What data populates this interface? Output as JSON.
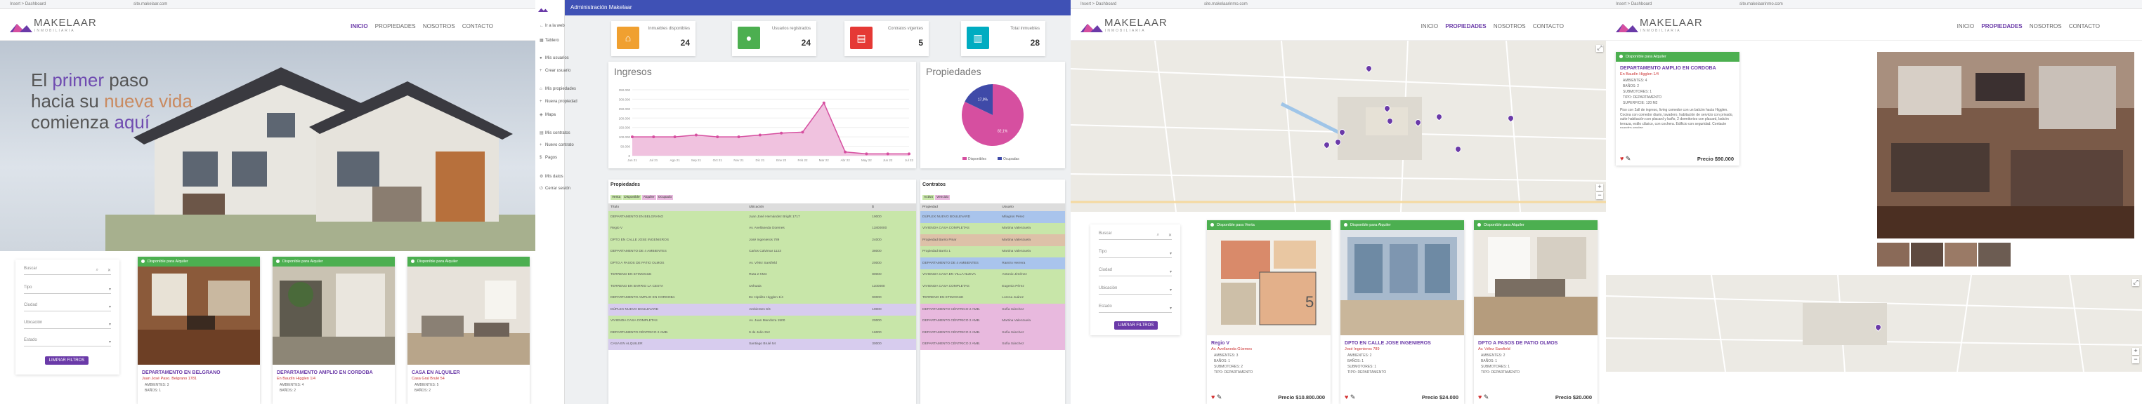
{
  "browser": {
    "left": "Insert > Dashboard",
    "url": "site.makelaar.com",
    "url2": "site.makelaarinmo.com"
  },
  "brand": {
    "name": "MAKELAAR",
    "tagline": "INMOBILIARIA",
    "accent": "#6a3aa8",
    "green": "#4caf50"
  },
  "nav": {
    "items": [
      "INICIO",
      "PROPIEDADES",
      "NOSOTROS",
      "CONTACTO"
    ]
  },
  "hero": {
    "line1a": "El ",
    "line1b": "primer",
    "line1c": " paso",
    "line2a": "hacia su ",
    "line2b": "nueva vida",
    "line3a": "comienza ",
    "line3b": "aquí"
  },
  "filters": {
    "search_placeholder": "Buscar",
    "fields": [
      "Tipo",
      "Ciudad",
      "Ubicación",
      "Estado"
    ],
    "clear_button": "LIMPIAR FILTROS"
  },
  "home_cards": [
    {
      "badge": "Disponible para Alquiler",
      "title": "DEPARTAMENTO EN BELGRANO",
      "address": "Juan José Paso. Belgrano 1781",
      "features": [
        "AMBIENTES: 3",
        "BAÑOS: 1"
      ]
    },
    {
      "badge": "Disponible para Alquiler",
      "title": "DEPARTAMENTO AMPLIO EN CORDOBA",
      "address": "En Baudín Higglen 1/4",
      "features": [
        "AMBIENTES: 4",
        "BAÑOS: 2"
      ]
    },
    {
      "badge": "Disponible para Alquiler",
      "title": "CASA EN ALQUILER",
      "address": "Casa Gral Brulé 54",
      "features": [
        "AMBIENTES: 5",
        "BAÑOS: 2"
      ]
    }
  ],
  "admin": {
    "header": "Administración Makelaar",
    "sidebar": [
      "Ir a la web",
      "Tablero",
      "Mis usuarios",
      "Crear usuario",
      "Mis propiedades",
      "Nueva propiedad",
      "Mapa",
      "Mis contratos",
      "Nuevo contrato",
      "Pagos",
      "Mis datos",
      "Cerrar sesión"
    ],
    "stats": [
      {
        "label": "Inmuebles disponibles",
        "value": "24",
        "color": "#f0a030",
        "icon": "home-icon",
        "glyph": "⌂"
      },
      {
        "label": "Usuarios registrados",
        "value": "24",
        "color": "#4caf50",
        "icon": "user-icon",
        "glyph": "●"
      },
      {
        "label": "Contratos vigentes",
        "value": "5",
        "color": "#e53935",
        "icon": "document-icon",
        "glyph": "▤"
      },
      {
        "label": "Total inmuebles",
        "value": "28",
        "color": "#00acc1",
        "icon": "building-icon",
        "glyph": "▥"
      }
    ],
    "income_title": "Ingresos",
    "props_title": "Propiedades",
    "contracts_title": "Contratos",
    "pie_legend": [
      "Disponibles",
      "Ocupadas"
    ],
    "prop_tags": [
      "Venta",
      "Disponible",
      "Alquiler",
      "Ocupado"
    ],
    "contract_tags": [
      "Activo",
      "Vencido"
    ],
    "prop_headers": [
      "Título",
      "Ubicación",
      "$"
    ],
    "prop_rows": [
      {
        "c": "rg",
        "t": "DEPARTAMENTO EN BELGRANO",
        "u": "Juan José Hernández Bright 1717",
        "p": "19000"
      },
      {
        "c": "rg",
        "t": "Regio V",
        "u": "Av. Avellaneda Güemes",
        "p": "11800000"
      },
      {
        "c": "rg",
        "t": "DPTO EN CALLE JOSE INGENIEROS",
        "u": "José Ingenieros 789",
        "p": "24000"
      },
      {
        "c": "rg",
        "t": "DEPARTAMENTO DE 4 AMBIENTES",
        "u": "Carlos Calvimar 1123",
        "p": "38000"
      },
      {
        "c": "rg",
        "t": "DPTO A PASOS DE PATIO OLMOS",
        "u": "Av. Vélez Sarsfield",
        "p": "20000"
      },
      {
        "c": "rg",
        "t": "TERRENO EN ETIMOGUE",
        "u": "Ruta 2 KM4",
        "p": "80000"
      },
      {
        "c": "rg",
        "t": "TERRENO EN BARRIO LA CESTA",
        "u": "Ushuaia",
        "p": "1100000"
      },
      {
        "c": "rg",
        "t": "DEPARTAMENTO AMPLIO EN CORDOBA",
        "u": "En Hipólito Higglen 1/4",
        "p": "90000"
      },
      {
        "c": "rl",
        "t": "DÚPLEX NUEVO BOULEVARD",
        "u": "Ambientes 8/4",
        "p": "19000"
      },
      {
        "c": "rg",
        "t": "VIVIENDA CASA COMPLETAS",
        "u": "Av. Juan Mendoza 1500",
        "p": "20000"
      },
      {
        "c": "rg",
        "t": "DEPARTAMENTO CÉNTRICO 2 AMB.",
        "u": "9 de Julio 312",
        "p": "16000"
      },
      {
        "c": "rl",
        "t": "CASA EN ALQUILER",
        "u": "Santiago Brulé 54",
        "p": "30000"
      }
    ],
    "contract_headers": [
      "Propiedad",
      "Usuario"
    ],
    "contract_rows": [
      {
        "c": "rb",
        "t": "DÚPLEX NUEVO BOULEVARD",
        "u": "Milagros Pérez"
      },
      {
        "c": "rg",
        "t": "VIVIENDA CASA COMPLETAS",
        "u": "Martina Valenzuela"
      },
      {
        "c": "rw",
        "t": "Propiedad Barrio Pinar",
        "u": "Martina Valenzuela"
      },
      {
        "c": "rg",
        "t": "Propiedad Barrio 1",
        "u": "Martina Valenzuela"
      },
      {
        "c": "rb",
        "t": "DEPARTAMENTO DE 4 AMBIENTES",
        "u": "Ramiro Herrera"
      },
      {
        "c": "rg",
        "t": "VIVIENDA CASA EN VILLA NUEVA",
        "u": "Antonio Jiménez"
      },
      {
        "c": "rg",
        "t": "VIVIENDA CASA COMPLETAS",
        "u": "Eugenia Pérez"
      },
      {
        "c": "rg",
        "t": "TERRENO EN ETIMOGUE",
        "u": "Lorena Juárez"
      },
      {
        "c": "rp",
        "t": "DEPARTAMENTO CÉNTRICO 2 AMB.",
        "u": "Sofía Sánchez"
      },
      {
        "c": "rp",
        "t": "DEPARTAMENTO CÉNTRICO 2 AMB.",
        "u": "Martina Valenzuela"
      },
      {
        "c": "rp",
        "t": "DEPARTAMENTO CÉNTRICO 2 AMB.",
        "u": "Sofía Sánchez"
      },
      {
        "c": "rp",
        "t": "DEPARTAMENTO CÉNTRICO 2 AMB.",
        "u": "Sofía Sánchez"
      }
    ]
  },
  "chart_data": [
    {
      "type": "area",
      "title": "Ingresos",
      "x": [
        "Jun 21",
        "Jul 21",
        "Ago 21",
        "Sep 21",
        "Oct 21",
        "Nov 21",
        "Dic 21",
        "Ene 22",
        "Feb 22",
        "Mar 22",
        "Abr 22",
        "May 22",
        "Jun 22",
        "Jul 22"
      ],
      "values": [
        100000,
        100000,
        100000,
        110000,
        100000,
        100000,
        110000,
        120000,
        125000,
        280000,
        20000,
        10000,
        10000,
        10000
      ],
      "ylim": [
        0,
        350000
      ],
      "yticks": [
        "350.000",
        "300.000",
        "250.000",
        "200.000",
        "150.000",
        "100.000",
        "50.000",
        "0"
      ],
      "color": "#d64fa0"
    },
    {
      "type": "pie",
      "title": "Propiedades",
      "categories": [
        "Disponibles",
        "Ocupadas"
      ],
      "values": [
        82.1,
        17.9
      ],
      "labels": [
        "82,1%",
        "17,9%"
      ],
      "colors": [
        "#d64fa0",
        "#3f4aa8"
      ]
    }
  ],
  "map_page": {
    "cards": [
      {
        "badge": "Disponible para Venta",
        "title": "Regio V",
        "address": "Av. Avellaneda Güemes",
        "features": [
          "AMBIENTES: 3",
          "BAÑOS: 1",
          "SUBMOTORES: 2",
          "TIPO: DEPARTAMENTO"
        ],
        "price": "Precio $10.800.000"
      },
      {
        "badge": "Disponible para Alquiler",
        "title": "DPTO EN CALLE JOSE INGENIEROS",
        "address": "José Ingenieros 789",
        "features": [
          "AMBIENTES: 2",
          "BAÑOS: 1",
          "SUBMOTORES: 1",
          "TIPO: DEPARTAMENTO"
        ],
        "price": "Precio $24.000"
      },
      {
        "badge": "Disponible para Alquiler",
        "title": "DPTO A PASOS DE PATIO OLMOS",
        "address": "Av. Vélez Sarsfield",
        "features": [
          "AMBIENTES: 2",
          "BAÑOS: 1",
          "SUBMOTORES: 1",
          "TIPO: DEPARTAMENTO"
        ],
        "price": "Precio $20.000"
      }
    ]
  },
  "detail": {
    "badge": "Disponible para Alquiler",
    "title": "DEPARTAMENTO AMPLIO EN CORDOBA",
    "address": "En Baudín Higglen 1/4",
    "features": [
      "AMBIENTES: 4",
      "BAÑOS: 2",
      "SUBMOTORES: 1",
      "TIPO: DEPARTAMENTO",
      "SUPERFICIE: 120 M2"
    ],
    "description": "Piso con 2all de ingreso, living comedor con un balcón hacia Higglen. Cocina con comedor diario, lavadero, habitación de servicio con privado, suite habitación con placard y baño, 2 dormitorios con placard, balcón terraza, estilo clásico, con cochera. Edificio con seguridad. Contacte nuestro equipo.",
    "price": "Precio $90.000"
  }
}
